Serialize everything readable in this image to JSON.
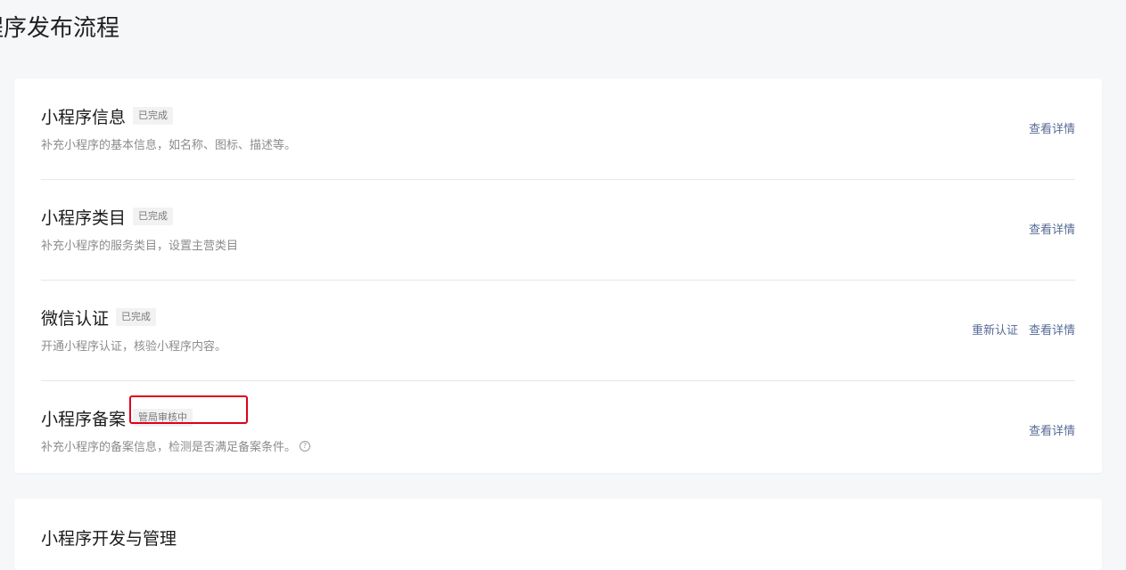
{
  "page": {
    "title": "程序发布流程"
  },
  "steps": [
    {
      "title": "小程序信息",
      "badge": "已完成",
      "desc": "补充小程序的基本信息，如名称、图标、描述等。",
      "actions": [
        "查看详情"
      ]
    },
    {
      "title": "小程序类目",
      "badge": "已完成",
      "desc": "补充小程序的服务类目，设置主营类目",
      "actions": [
        "查看详情"
      ]
    },
    {
      "title": "微信认证",
      "badge": "已完成",
      "desc": "开通小程序认证，核验小程序内容。",
      "actions": [
        "重新认证",
        "查看详情"
      ]
    },
    {
      "title": "小程序备案",
      "badge": "管局审核中",
      "desc": "补充小程序的备案信息，检测是否满足备案条件。",
      "help_icon": "?",
      "actions": [
        "查看详情"
      ]
    }
  ],
  "dev": {
    "title": "小程序开发与管理"
  },
  "colors": {
    "link": "#576b95",
    "highlight": "#e0001b",
    "background": "#f6f7f9"
  }
}
